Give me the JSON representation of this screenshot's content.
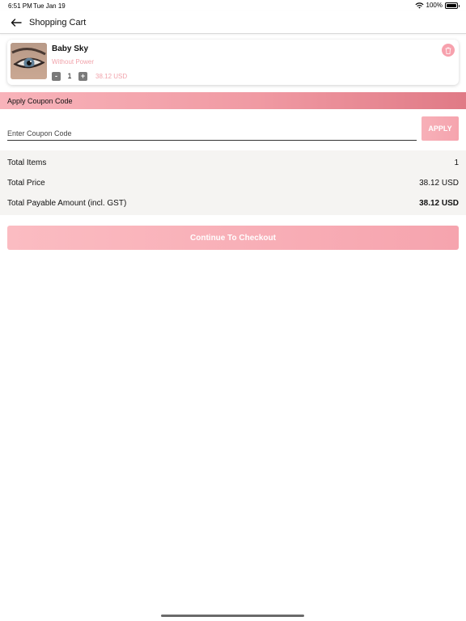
{
  "status_bar": {
    "time": "6:51 PM",
    "date": "Tue Jan 19",
    "battery": "100%"
  },
  "nav": {
    "title": "Shopping Cart"
  },
  "cart": {
    "items": [
      {
        "name": "Baby Sky",
        "variant": "Without Power",
        "quantity": "1",
        "minus_label": "-",
        "plus_label": "+",
        "price": "38.12 USD"
      }
    ]
  },
  "coupon": {
    "header": "Apply Coupon Code",
    "placeholder": "Enter Coupon Code",
    "value": "",
    "apply_label": "APPLY"
  },
  "summary": {
    "rows": [
      {
        "label": "Total Items",
        "value": "1"
      },
      {
        "label": "Total Price",
        "value": "38.12 USD"
      },
      {
        "label": "Total Payable Amount (incl. GST)",
        "value": "38.12 USD"
      }
    ]
  },
  "checkout": {
    "label": "Continue To Checkout"
  },
  "colors": {
    "accent_pink": "#f6a4ae",
    "coupon_header_end": "#e07a86",
    "price_text": "#f1a3ab"
  },
  "icons": {
    "back": "arrow-left-icon",
    "delete": "trash-icon",
    "wifi": "wifi-icon",
    "battery": "battery-icon"
  }
}
